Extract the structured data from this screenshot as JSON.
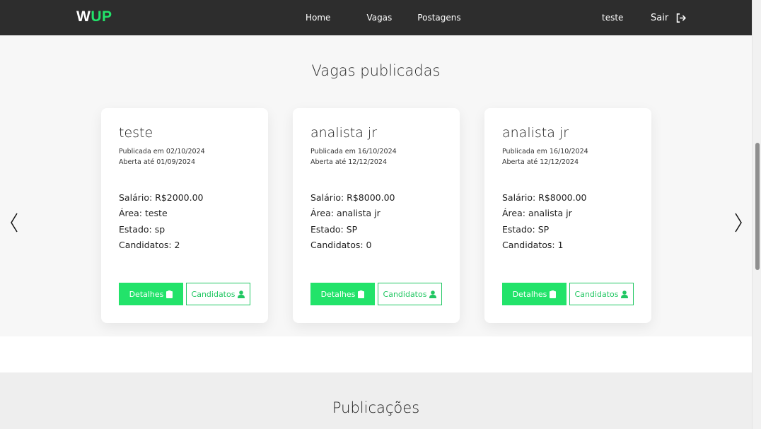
{
  "navbar": {
    "logo_w": "W",
    "logo_up": "UP",
    "links": [
      "Home",
      "Vagas",
      "Postagens"
    ],
    "user_name": "teste",
    "logout_label": "Sair"
  },
  "jobs": {
    "section_title": "Vagas publicadas",
    "cards": [
      {
        "title": "teste",
        "published": "Publicada em 02/10/2024",
        "open_until": "Aberta até 01/09/2024",
        "salary": "Salário: R$2000.00",
        "area": "Área: teste",
        "state": "Estado: sp",
        "candidates": "Candidatos: 2",
        "details_label": "Detalhes",
        "candidates_label": "Candidatos"
      },
      {
        "title": "analista jr",
        "published": "Publicada em 16/10/2024",
        "open_until": "Aberta até 12/12/2024",
        "salary": "Salário: R$8000.00",
        "area": "Área: analista jr",
        "state": "Estado: SP",
        "candidates": "Candidatos: 0",
        "details_label": "Detalhes",
        "candidates_label": "Candidatos"
      },
      {
        "title": "analista jr",
        "published": "Publicada em 16/10/2024",
        "open_until": "Aberta até 12/12/2024",
        "salary": "Salário: R$8000.00",
        "area": "Área: analista jr",
        "state": "Estado: SP",
        "candidates": "Candidatos: 1",
        "details_label": "Detalhes",
        "candidates_label": "Candidatos"
      }
    ]
  },
  "posts": {
    "section_title": "Publicações"
  },
  "icons": {
    "logout": "logout-icon",
    "details": "clipboard-icon",
    "candidates": "user-icon",
    "prev": "chevron-left-icon",
    "next": "chevron-right-icon"
  },
  "colors": {
    "accent": "#22e36a",
    "navbar": "#2d2d2d",
    "section_bg": "#f7f7f7"
  }
}
